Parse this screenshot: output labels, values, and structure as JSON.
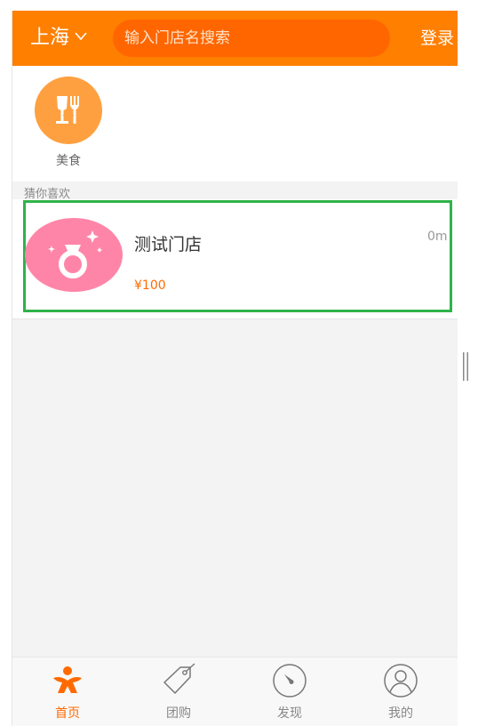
{
  "header": {
    "city": "上海",
    "search_placeholder": "输入门店名搜索",
    "login_label": "登录"
  },
  "categories": [
    {
      "label": "美食",
      "icon": "food-icon"
    }
  ],
  "section": {
    "title": "猜你喜欢"
  },
  "stores": [
    {
      "name": "测试门店",
      "price": "¥100",
      "distance": "0m",
      "icon": "ring-icon"
    }
  ],
  "tabs": [
    {
      "label": "首页",
      "icon": "home-icon",
      "active": true
    },
    {
      "label": "团购",
      "icon": "tag-icon",
      "active": false
    },
    {
      "label": "发现",
      "icon": "compass-icon",
      "active": false
    },
    {
      "label": "我的",
      "icon": "user-icon",
      "active": false
    }
  ],
  "colors": {
    "brand": "#ff7f00",
    "search_bg": "#ff6600",
    "price": "#ff6a00",
    "highlight": "#2fb34a",
    "category_circle": "#ffa040",
    "store_image_bg": "#ff85a8"
  }
}
